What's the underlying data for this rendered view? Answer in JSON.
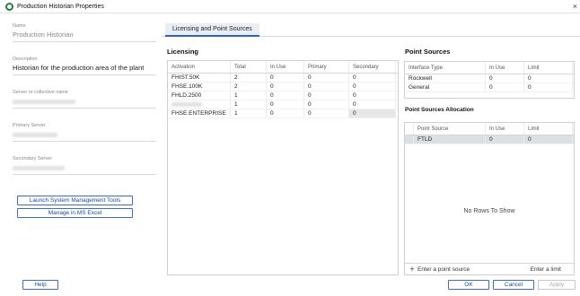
{
  "window": {
    "title": "Production Historian Properties",
    "close_glyph": "×"
  },
  "left": {
    "name_label": "Name",
    "name_value": "Production Historian",
    "description_label": "Description",
    "description_value": "Historian for the production area of the plant",
    "server_label": "Server or collective name",
    "primary_label": "Primary Server",
    "secondary_label": "Secondary Server",
    "launch_button": "Launch System Management Tools",
    "excel_button": "Manage in MS Excel"
  },
  "tabs": [
    {
      "label": "Licensing and Point Sources"
    }
  ],
  "licensing": {
    "title": "Licensing",
    "columns": [
      "Activation",
      "Total",
      "In Use",
      "Primary",
      "Secondary"
    ],
    "rows": [
      [
        "FHIST.50K",
        "2",
        "0",
        "0",
        "0"
      ],
      [
        "FHSE.100K",
        "2",
        "0",
        "0",
        "0"
      ],
      [
        "FHLD.2500",
        "1",
        "0",
        "0",
        "0"
      ],
      [
        "",
        "1",
        "0",
        "0",
        "0"
      ],
      [
        "FHSE.ENTERPRISE",
        "1",
        "0",
        "0",
        "0"
      ]
    ]
  },
  "point_sources": {
    "title": "Point Sources",
    "columns": [
      "Interface Type",
      "In Use",
      "Limit"
    ],
    "rows": [
      [
        "Rockwell",
        "0",
        "0"
      ],
      [
        "General",
        "0",
        "0"
      ]
    ]
  },
  "allocation": {
    "title": "Point Sources Allocation",
    "columns": [
      "Point Source",
      "In Use",
      "Limit"
    ],
    "rows": [
      [
        "FTLD",
        "0",
        "0"
      ]
    ],
    "empty_text": "No Rows To Show",
    "add_placeholder": "Enter a point source",
    "limit_placeholder": "Enter a limit",
    "plus_glyph": "+"
  },
  "footer": {
    "help": "Help",
    "ok": "OK",
    "cancel": "Cancel",
    "apply": "Apply"
  }
}
